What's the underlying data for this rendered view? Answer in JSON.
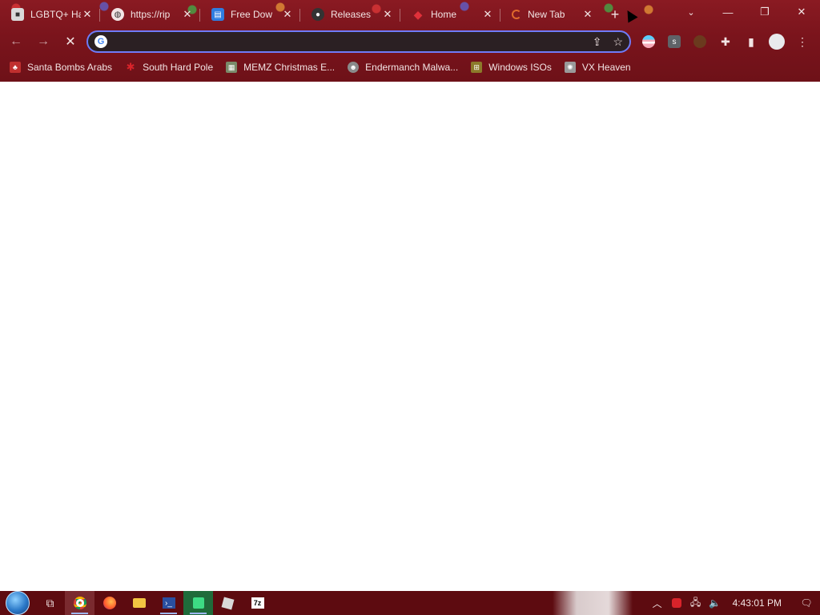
{
  "browser": {
    "tabs": [
      {
        "title": "LGBTQ+ Ha",
        "favicon": "roblox-icon",
        "color": "#d9d9d9"
      },
      {
        "title": "https://rip",
        "favicon": "globe-icon",
        "color": "#6b6b6b"
      },
      {
        "title": "Free Dow",
        "favicon": "docs-icon",
        "color": "#2f7de1"
      },
      {
        "title": "Releases",
        "favicon": "github-icon",
        "color": "#333333"
      },
      {
        "title": "Home",
        "favicon": "ruby-icon",
        "color": "#d8232a"
      },
      {
        "title": "New Tab",
        "favicon": "loading-icon",
        "color": "#e06a2c",
        "active": true
      }
    ],
    "new_tab_label": "+",
    "address_value": "",
    "bookmarks": [
      {
        "label": "Santa Bombs Arabs",
        "icon": "santa-icon",
        "color": "#c0302f"
      },
      {
        "label": "South Hard Pole",
        "icon": "star-icon",
        "color": "#d8232a"
      },
      {
        "label": "MEMZ Christmas E...",
        "icon": "memz-icon",
        "color": "#7a8a6a"
      },
      {
        "label": "Endermanch Malwa...",
        "icon": "skull-icon",
        "color": "#8a8a8a"
      },
      {
        "label": "Windows ISOs",
        "icon": "windows-icon",
        "color": "#8c7a2a"
      },
      {
        "label": "VX Heaven",
        "icon": "virus-icon",
        "color": "#9a9a9a"
      }
    ]
  },
  "taskbar": {
    "clock": "4:43:01 PM",
    "apps": [
      "task-view-icon",
      "chrome-icon",
      "firefox-icon",
      "file-explorer-icon",
      "powershell-icon",
      "green-app-icon",
      "roblox-icon",
      "7zip-icon"
    ]
  },
  "colors": {
    "frame": "#7a141c",
    "accent": "#6f7bf7",
    "taskbar": "#5d0b10"
  }
}
